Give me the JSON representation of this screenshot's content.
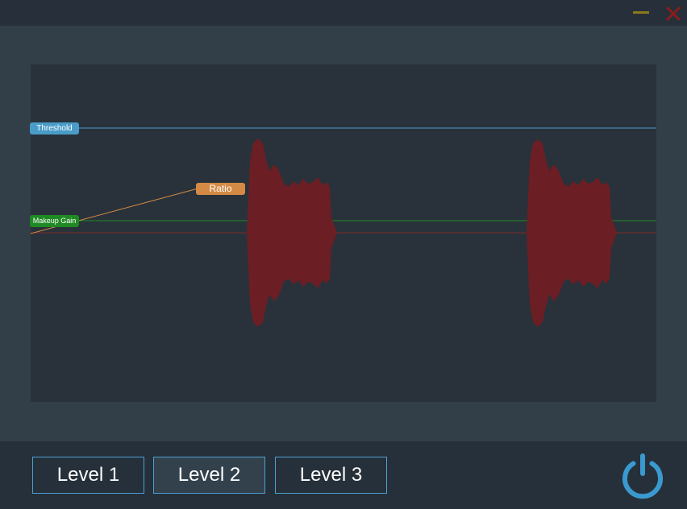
{
  "titlebar": {
    "minimize_icon": "minimize-icon",
    "close_icon": "close-icon",
    "colors": {
      "minimize": "#8a7a1c",
      "close": "#8b1c1c"
    }
  },
  "display": {
    "markers": {
      "threshold_label": "Threshold",
      "ratio_label": "Ratio",
      "makeup_gain_label": "Makeup Gain"
    },
    "colors": {
      "threshold": "#4a9cc8",
      "ratio": "#d48a45",
      "makeup_gain": "#1f8a24",
      "waveform": "#6b1e24",
      "baseline": "#7a2a2a"
    },
    "waveform_bursts": 2
  },
  "level_buttons": [
    {
      "label": "Level 1",
      "selected": false
    },
    {
      "label": "Level 2",
      "selected": true
    },
    {
      "label": "Level 3",
      "selected": false
    }
  ],
  "power": {
    "icon": "power-icon",
    "color": "#3a9ad0"
  }
}
